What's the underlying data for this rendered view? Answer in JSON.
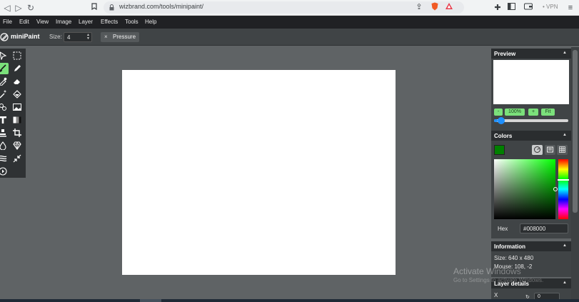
{
  "browser": {
    "url": "wizbrand.com/tools/minipaint/",
    "vpn": "• VPN"
  },
  "menu": [
    "File",
    "Edit",
    "View",
    "Image",
    "Layer",
    "Effects",
    "Tools",
    "Help"
  ],
  "app": {
    "name": "miniPaint",
    "size_label": "Size:",
    "size_value": "4",
    "pressure_label": "Pressure",
    "pressure_toggle": "×"
  },
  "preview": {
    "title": "Preview",
    "zoom_minus": "-",
    "zoom_value": "100%",
    "zoom_plus": "+",
    "zoom_fit": "Fit",
    "zoom_slider_fraction": 0.05
  },
  "colors": {
    "title": "Colors",
    "current_color": "#008000",
    "hex_label": "Hex",
    "hex_value": "#008000"
  },
  "information": {
    "title": "Information",
    "size": "Size: 640 x 480",
    "mouse": "Mouse: 108, -2"
  },
  "layer_details": {
    "title": "Layer details",
    "x_label": "X",
    "x_value": "0"
  },
  "watermark": {
    "line1": "Activate Windows",
    "line2": "Go to Settings to activate Windows."
  },
  "icons": [
    "back-icon",
    "forward-icon",
    "reload-icon",
    "bookmark-icon",
    "share-icon",
    "brave-icon",
    "rewards-icon",
    "extensions-icon",
    "sidebar-icon",
    "wallet-icon",
    "menu-icon"
  ]
}
